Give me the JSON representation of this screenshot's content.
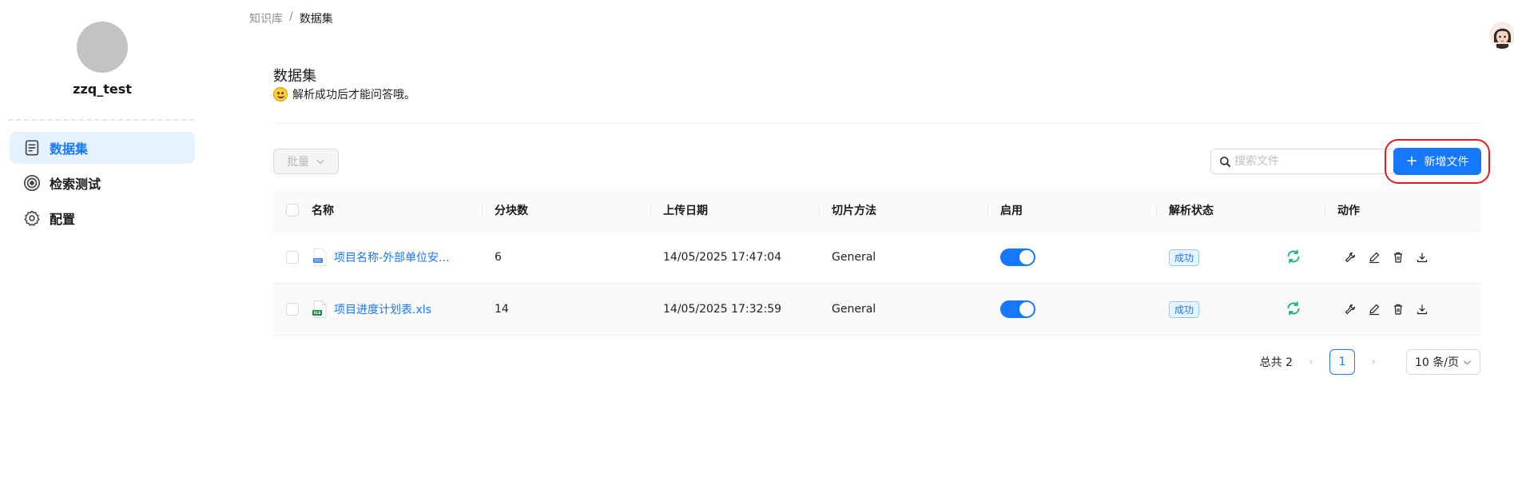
{
  "sidebar": {
    "username": "zzq_test",
    "items": [
      {
        "label": "数据集",
        "icon": "document-icon",
        "active": true
      },
      {
        "label": "检索测试",
        "icon": "target-icon",
        "active": false
      },
      {
        "label": "配置",
        "icon": "gear-icon",
        "active": false
      }
    ]
  },
  "breadcrumb": {
    "parent": "知识库",
    "separator": "/",
    "current": "数据集"
  },
  "header": {
    "title": "数据集",
    "subtitle": "解析成功后才能问答哦。"
  },
  "toolbar": {
    "bulk_label": "批量",
    "search_placeholder": "搜索文件",
    "add_label": "新增文件"
  },
  "table": {
    "columns": [
      "名称",
      "分块数",
      "上传日期",
      "切片方法",
      "启用",
      "解析状态",
      "动作"
    ],
    "rows": [
      {
        "name": "项目名称-外部单位安...",
        "file_type": "doc",
        "chunks": "6",
        "upload_date": "14/05/2025 17:47:04",
        "method": "General",
        "enabled": true,
        "status": "成功"
      },
      {
        "name": "项目进度计划表.xls",
        "file_type": "xls",
        "chunks": "14",
        "upload_date": "14/05/2025 17:32:59",
        "method": "General",
        "enabled": true,
        "status": "成功"
      }
    ]
  },
  "pagination": {
    "total_label": "总共 2",
    "current_page": "1",
    "page_size": "10 条/页"
  },
  "colors": {
    "primary": "#1677ff",
    "success": "#19b377",
    "highlight_box": "#e31b1b"
  }
}
